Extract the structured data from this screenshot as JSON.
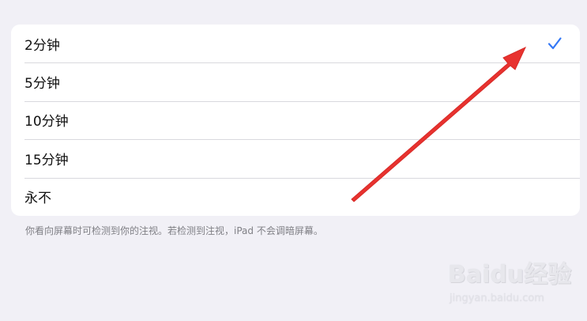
{
  "options": {
    "items": [
      {
        "label": "2分钟",
        "selected": true
      },
      {
        "label": "5分钟",
        "selected": false
      },
      {
        "label": "10分钟",
        "selected": false
      },
      {
        "label": "15分钟",
        "selected": false
      },
      {
        "label": "永不",
        "selected": false
      }
    ],
    "check_icon": "checkmark-icon",
    "accent_color": "#3478f6"
  },
  "footer": {
    "note": "你看向屏幕时可检测到你的注视。若检测到注视，iPad 不会调暗屏幕。"
  },
  "annotation": {
    "arrow_color": "#e8322f"
  },
  "watermark": {
    "logo_text": "Baidu经验",
    "url_text": "jingyan.baidu.com"
  }
}
